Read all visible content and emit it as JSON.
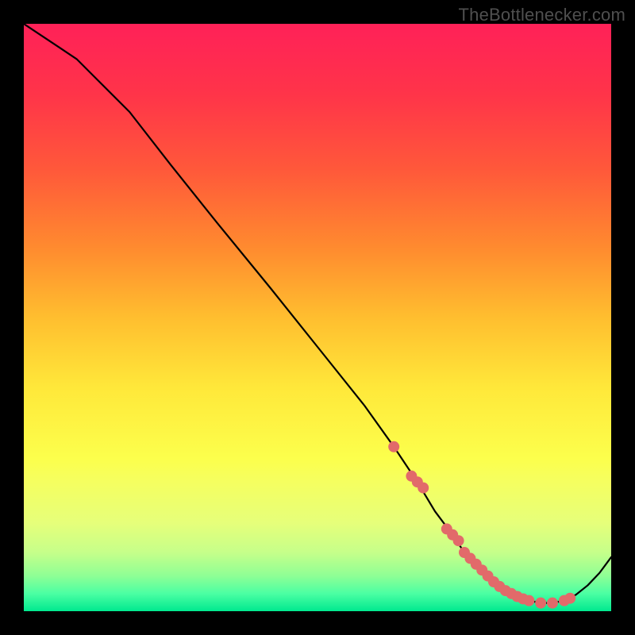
{
  "watermark": "TheBottlenecker.com",
  "chart_data": {
    "type": "line",
    "title": "",
    "xlabel": "",
    "ylabel": "",
    "xlim": [
      0,
      100
    ],
    "ylim": [
      0,
      100
    ],
    "grid": false,
    "background_gradient": {
      "stops": [
        {
          "pos": 0.0,
          "color": "#ff2158"
        },
        {
          "pos": 0.12,
          "color": "#ff3449"
        },
        {
          "pos": 0.25,
          "color": "#ff593a"
        },
        {
          "pos": 0.38,
          "color": "#ff8a2f"
        },
        {
          "pos": 0.5,
          "color": "#ffbe2f"
        },
        {
          "pos": 0.62,
          "color": "#ffe83a"
        },
        {
          "pos": 0.74,
          "color": "#fcff4c"
        },
        {
          "pos": 0.78,
          "color": "#f5ff60"
        },
        {
          "pos": 0.85,
          "color": "#e6ff7a"
        },
        {
          "pos": 0.9,
          "color": "#c6ff8a"
        },
        {
          "pos": 0.94,
          "color": "#8eff95"
        },
        {
          "pos": 0.97,
          "color": "#4bffa3"
        },
        {
          "pos": 1.0,
          "color": "#00e98f"
        }
      ]
    },
    "series": [
      {
        "name": "bottleneck-curve",
        "color": "#000000",
        "stroke_width": 2.2,
        "x": [
          0,
          3,
          6,
          9,
          12,
          18,
          25,
          33,
          42,
          50,
          58,
          63,
          67,
          70,
          73,
          75,
          78,
          80,
          82,
          84,
          86,
          88,
          90,
          92,
          94,
          96,
          98,
          100
        ],
        "values": [
          100,
          98,
          96,
          94,
          91,
          85,
          76,
          66,
          55,
          45,
          35,
          28,
          22,
          17,
          13,
          10,
          7,
          5,
          3.5,
          2.5,
          1.8,
          1.4,
          1.4,
          1.8,
          2.8,
          4.4,
          6.5,
          9.2
        ]
      }
    ],
    "markers": {
      "name": "highlight-dots",
      "color": "#e26a6a",
      "radius": 7,
      "x": [
        63,
        66,
        67,
        68,
        72,
        73,
        74,
        75,
        76,
        77,
        78,
        79,
        80,
        81,
        82,
        83,
        84,
        85,
        86,
        88,
        90,
        92,
        93
      ],
      "values": [
        28,
        23,
        22,
        21,
        14,
        13,
        12,
        10,
        9,
        8,
        7,
        6,
        5,
        4.2,
        3.5,
        3,
        2.5,
        2.1,
        1.8,
        1.4,
        1.4,
        1.8,
        2.2
      ]
    }
  }
}
